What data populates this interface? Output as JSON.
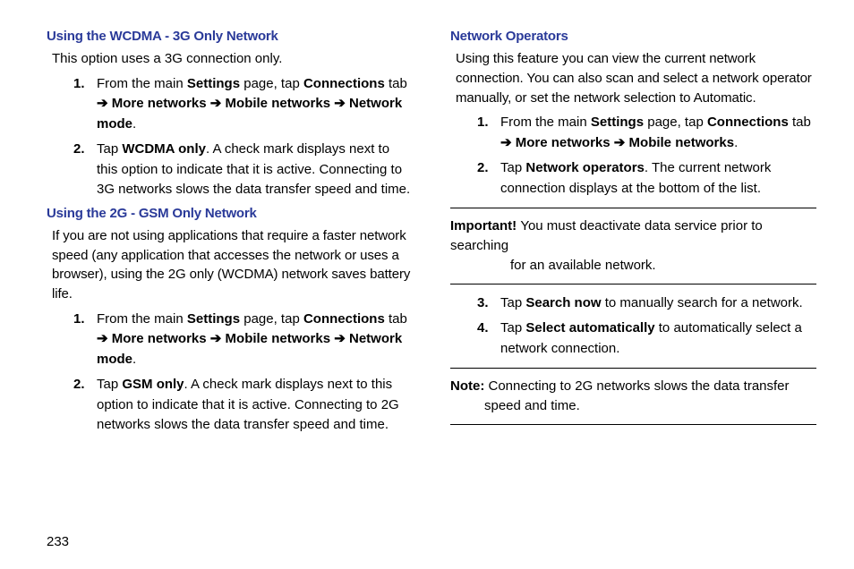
{
  "left": {
    "heading1": "Using the WCDMA - 3G Only Network",
    "intro1": "This option uses a 3G connection only.",
    "list1": [
      {
        "num": "1.",
        "parts": [
          {
            "t": "From the main "
          },
          {
            "t": "Settings",
            "b": true
          },
          {
            "t": " page, tap "
          },
          {
            "t": "Connections",
            "b": true
          },
          {
            "t": " tab "
          },
          {
            "t": "➔",
            "b": true
          },
          {
            "t": " "
          },
          {
            "t": "More networks",
            "b": true
          },
          {
            "t": " "
          },
          {
            "t": "➔",
            "b": true
          },
          {
            "t": " "
          },
          {
            "t": "Mobile networks",
            "b": true
          },
          {
            "t": " "
          },
          {
            "t": "➔",
            "b": true
          },
          {
            "t": " "
          },
          {
            "t": "Network mode",
            "b": true
          },
          {
            "t": "."
          }
        ]
      },
      {
        "num": "2.",
        "parts": [
          {
            "t": "Tap "
          },
          {
            "t": "WCDMA only",
            "b": true
          },
          {
            "t": ". A check mark displays next to this option to indicate that it is active. Connecting to 3G networks slows the data transfer speed and time."
          }
        ]
      }
    ],
    "heading2": "Using the 2G - GSM Only Network",
    "intro2": "If you are not using applications that require a faster network speed (any application that accesses the network or uses a browser), using the 2G only (WCDMA) network saves battery life.",
    "list2": [
      {
        "num": "1.",
        "parts": [
          {
            "t": "From the main "
          },
          {
            "t": "Settings",
            "b": true
          },
          {
            "t": " page, tap "
          },
          {
            "t": "Connections",
            "b": true
          },
          {
            "t": " tab "
          },
          {
            "t": "➔",
            "b": true
          },
          {
            "t": " "
          },
          {
            "t": "More networks",
            "b": true
          },
          {
            "t": " "
          },
          {
            "t": "➔",
            "b": true
          },
          {
            "t": " "
          },
          {
            "t": "Mobile networks",
            "b": true
          },
          {
            "t": " "
          },
          {
            "t": "➔",
            "b": true
          },
          {
            "t": " "
          },
          {
            "t": "Network mode",
            "b": true
          },
          {
            "t": "."
          }
        ]
      },
      {
        "num": "2.",
        "parts": [
          {
            "t": "Tap "
          },
          {
            "t": "GSM only",
            "b": true
          },
          {
            "t": ". A check mark displays next to this option to indicate that it is active. Connecting to 2G networks slows the data transfer speed and time."
          }
        ]
      }
    ]
  },
  "right": {
    "heading1": "Network Operators",
    "intro1": "Using this feature you can view the current network connection. You can also scan and select a network operator manually, or set the network selection to Automatic.",
    "list1": [
      {
        "num": "1.",
        "parts": [
          {
            "t": "From the main "
          },
          {
            "t": "Settings",
            "b": true
          },
          {
            "t": " page, tap "
          },
          {
            "t": "Connections",
            "b": true
          },
          {
            "t": " tab "
          },
          {
            "t": "➔",
            "b": true
          },
          {
            "t": " "
          },
          {
            "t": "More networks",
            "b": true
          },
          {
            "t": " "
          },
          {
            "t": "➔",
            "b": true
          },
          {
            "t": " "
          },
          {
            "t": "Mobile networks",
            "b": true
          },
          {
            "t": "."
          }
        ]
      },
      {
        "num": "2.",
        "parts": [
          {
            "t": "Tap "
          },
          {
            "t": "Network operators",
            "b": true
          },
          {
            "t": ". The current network connection displays at the bottom of the list."
          }
        ]
      }
    ],
    "important": {
      "label": "Important! ",
      "text_line1": "You must deactivate data service prior to searching",
      "text_line2": "for an available network."
    },
    "list2": [
      {
        "num": "3.",
        "parts": [
          {
            "t": "Tap "
          },
          {
            "t": "Search now",
            "b": true
          },
          {
            "t": " to manually search for a network."
          }
        ]
      },
      {
        "num": "4.",
        "parts": [
          {
            "t": "Tap "
          },
          {
            "t": "Select automatically",
            "b": true
          },
          {
            "t": " to automatically select a network connection."
          }
        ]
      }
    ],
    "note": {
      "label": "Note: ",
      "text_line1": "Connecting to 2G networks slows the data transfer",
      "text_line2": "speed and time."
    }
  },
  "page": "233"
}
